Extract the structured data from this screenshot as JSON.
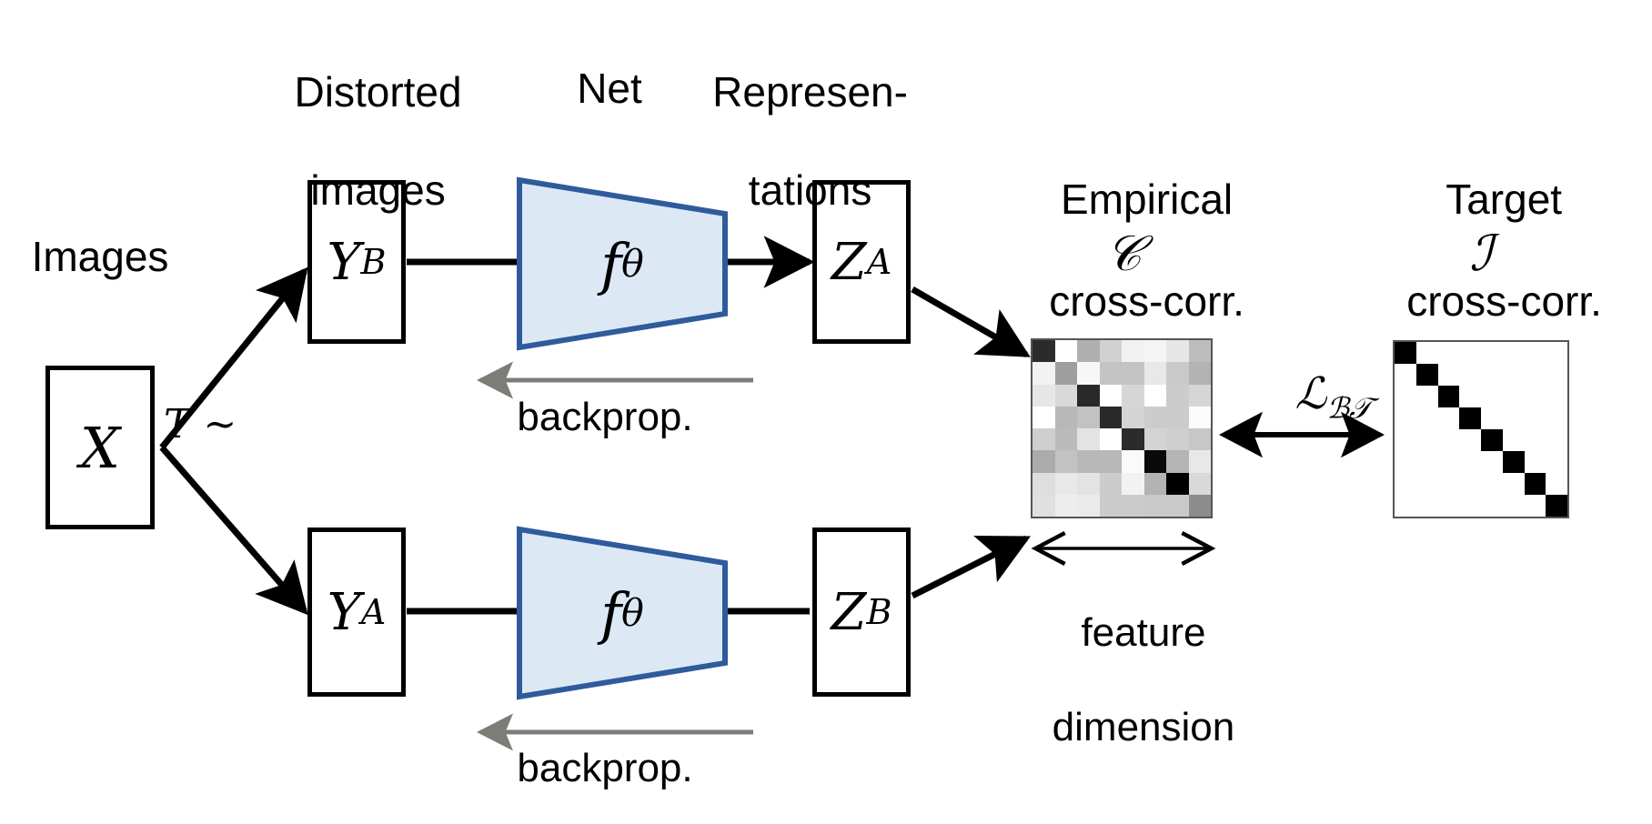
{
  "figure": {
    "title": "Barlow Twins method diagram",
    "colors": {
      "net_fill": "#dce9f5",
      "net_stroke": "#2f5b9c",
      "arrow_black": "#000000",
      "backprop_gray": "#7d7d78",
      "box_stroke": "#000000",
      "matrix_border": "#555555"
    }
  },
  "labels": {
    "images": "Images",
    "distorted_line1": "Distorted",
    "distorted_line2": "images",
    "net": "Net",
    "representations_line1": "Represen-",
    "representations_line2": "tations",
    "empirical_line1": "Empirical",
    "empirical_line2": "cross-corr.",
    "empirical_symbol": "𝒞",
    "target_line1": "Target",
    "target_line2": "cross-corr.",
    "target_symbol": "ℐ",
    "backprop_top": "backprop.",
    "backprop_bottom": "backprop.",
    "feature_line1": "feature",
    "feature_line2": "dimension",
    "transform_sample": "T ∼ 𝒣",
    "loss_symbol": "ℒ",
    "loss_subscript": "ℬ𝒯"
  },
  "nodes": {
    "input": {
      "symbol": "X",
      "sup": ""
    },
    "distorted_top": {
      "symbol": "Y",
      "sup": "B"
    },
    "distorted_bottom": {
      "symbol": "Y",
      "sup": "A"
    },
    "net_top": {
      "symbol": "f",
      "sub": "θ"
    },
    "net_bottom": {
      "symbol": "f",
      "sub": "θ"
    },
    "repr_top": {
      "symbol": "Z",
      "sup": "A"
    },
    "repr_bottom": {
      "symbol": "Z",
      "sup": "B"
    }
  },
  "chart_data": {
    "type": "heatmap",
    "title": "Empirical cross-correlation matrix C",
    "xlabel": "feature dimension",
    "ylabel": "feature dimension",
    "rows": 8,
    "cols": 8,
    "colormap": "grayscale",
    "vmin": 0,
    "vmax": 1,
    "note": "value = normalized grayscale luminance, 0 = black (high correlation), 1 = white",
    "empirical_values": [
      [
        0.17,
        1.0,
        0.69,
        0.82,
        0.95,
        0.96,
        0.9,
        0.74
      ],
      [
        0.95,
        0.62,
        0.97,
        0.77,
        0.77,
        0.91,
        0.79,
        0.7
      ],
      [
        0.9,
        0.85,
        0.16,
        1.0,
        0.84,
        1.0,
        0.8,
        0.84
      ],
      [
        1.0,
        0.72,
        0.76,
        0.16,
        0.83,
        0.8,
        0.8,
        0.99
      ],
      [
        0.81,
        0.73,
        0.89,
        1.0,
        0.17,
        0.83,
        0.81,
        0.78
      ],
      [
        0.67,
        0.76,
        0.72,
        0.72,
        0.98,
        0.04,
        0.71,
        0.91
      ],
      [
        0.87,
        0.91,
        0.89,
        0.8,
        0.95,
        0.7,
        0.0,
        0.85
      ],
      [
        0.88,
        0.93,
        0.92,
        0.8,
        0.8,
        0.79,
        0.79,
        0.55
      ]
    ],
    "target_values": [
      [
        0,
        1,
        1,
        1,
        1,
        1,
        1,
        1
      ],
      [
        1,
        0,
        1,
        1,
        1,
        1,
        1,
        1
      ],
      [
        1,
        1,
        0,
        1,
        1,
        1,
        1,
        1
      ],
      [
        1,
        1,
        1,
        0,
        1,
        1,
        1,
        1
      ],
      [
        1,
        1,
        1,
        1,
        0,
        1,
        1,
        1
      ],
      [
        1,
        1,
        1,
        1,
        1,
        0,
        1,
        1
      ],
      [
        1,
        1,
        1,
        1,
        1,
        1,
        0,
        1
      ],
      [
        1,
        1,
        1,
        1,
        1,
        1,
        1,
        0
      ]
    ]
  }
}
